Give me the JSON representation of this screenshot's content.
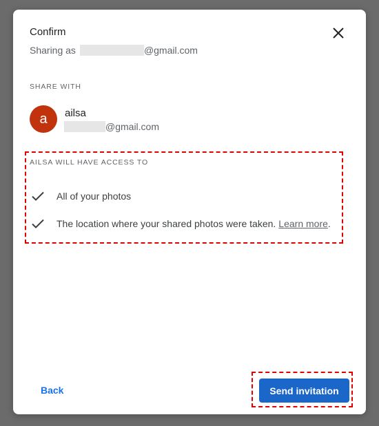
{
  "dialog": {
    "title": "Confirm",
    "sharing_as_prefix": "Sharing as",
    "sharing_as_domain": "@gmail.com",
    "close_icon": "close-icon"
  },
  "share_with": {
    "label": "SHARE WITH",
    "recipient": {
      "avatar_letter": "a",
      "avatar_color": "#c1330c",
      "name": "ailsa",
      "email_domain": "@gmail.com"
    }
  },
  "access": {
    "label": "AILSA WILL HAVE ACCESS TO",
    "items": [
      {
        "text": "All of your photos",
        "icon": "check-icon"
      },
      {
        "text": "The location where your shared photos were taken.",
        "link": "Learn more",
        "suffix": ".",
        "icon": "check-icon"
      }
    ]
  },
  "actions": {
    "back_label": "Back",
    "send_label": "Send invitation"
  },
  "colors": {
    "accent": "#1a73e8",
    "send_button": "#1a66c9",
    "highlight": "#e00000",
    "overlay": "#6b6b6b"
  }
}
